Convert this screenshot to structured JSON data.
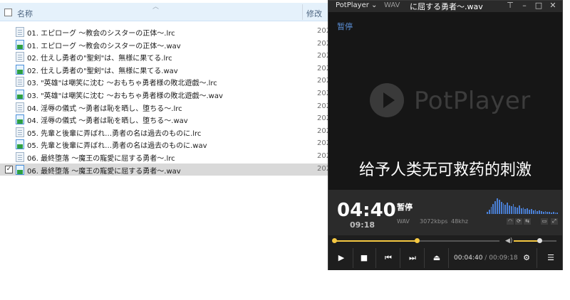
{
  "explorer": {
    "header": {
      "name_label": "名称",
      "date_label": "修改"
    },
    "files": [
      {
        "name": "01. エピローグ ～教会のシスターの正体～.lrc",
        "type": "lrc",
        "date": "202",
        "selected": false
      },
      {
        "name": "01. エピローグ ～教会のシスターの正体～.wav",
        "type": "wav",
        "date": "202",
        "selected": false
      },
      {
        "name": "02. 仕えし勇者の\"聖剣\"は、無様に果てる.lrc",
        "type": "lrc",
        "date": "202",
        "selected": false
      },
      {
        "name": "02. 仕えし勇者の\"聖剣\"は、無様に果てる.wav",
        "type": "wav",
        "date": "202",
        "selected": false
      },
      {
        "name": "03. \"英雄\"は嘲笑に沈む ～おもちゃ勇者様の敗北遊戯～.lrc",
        "type": "lrc",
        "date": "202",
        "selected": false
      },
      {
        "name": "03. \"英雄\"は嘲笑に沈む ～おもちゃ勇者様の敗北遊戯～.wav",
        "type": "wav",
        "date": "202",
        "selected": false
      },
      {
        "name": "04. 淫辱の儀式 ～勇者は恥を晒し、堕ちる～.lrc",
        "type": "lrc",
        "date": "202",
        "selected": false
      },
      {
        "name": "04. 淫辱の儀式 ～勇者は恥を晒し、堕ちる～.wav",
        "type": "wav",
        "date": "202",
        "selected": false
      },
      {
        "name": "05. 先輩と後輩に弄ばれ…勇者の名は過去のものに.lrc",
        "type": "lrc",
        "date": "202",
        "selected": false
      },
      {
        "name": "05. 先輩と後輩に弄ばれ…勇者の名は過去のものに.wav",
        "type": "wav",
        "date": "202",
        "selected": false
      },
      {
        "name": "06. 最終堕落 ～魔王の寵愛に屈する勇者～.lrc",
        "type": "lrc",
        "date": "202",
        "selected": false
      },
      {
        "name": "06. 最終堕落 ～魔王の寵愛に屈する勇者～.wav",
        "type": "wav",
        "date": "202",
        "selected": true
      }
    ]
  },
  "player": {
    "brand": "PotPlayer",
    "tab": "WAV",
    "title": "に屈する勇者～.wav",
    "paused_osd": "暂停",
    "logo_text": "PotPlayer",
    "subtitle": "给予人类无可救药的刺激",
    "current_time": "04:40",
    "total_time": "09:18",
    "state": "暂停",
    "format": "WAV",
    "bitrate": "3072kbps",
    "samplerate": "48khz",
    "progress": 0.5,
    "volume": 0.6,
    "clock_current": "00:04:40",
    "clock_sep": "/",
    "clock_total": "00:09:18",
    "accent": "#f5c842",
    "spectrum": [
      3,
      6,
      10,
      14,
      18,
      22,
      20,
      17,
      15,
      13,
      16,
      12,
      11,
      14,
      10,
      9,
      12,
      8,
      9,
      7,
      8,
      6,
      7,
      5,
      6,
      4,
      5,
      4,
      3,
      4,
      3,
      3,
      2,
      3,
      2,
      2
    ]
  }
}
